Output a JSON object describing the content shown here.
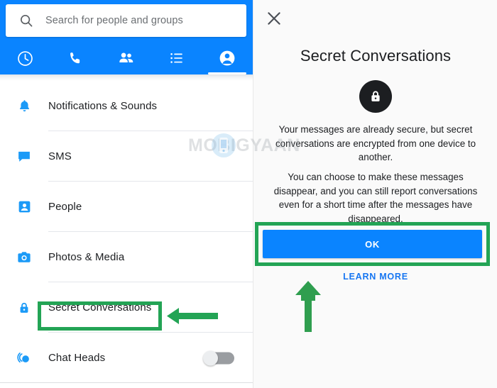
{
  "left_panel": {
    "search": {
      "placeholder": "Search for people and groups",
      "icon": "search-icon"
    },
    "tabs": [
      {
        "name": "recent",
        "icon": "clock-icon",
        "active": false
      },
      {
        "name": "calls",
        "icon": "phone-icon",
        "active": false
      },
      {
        "name": "people",
        "icon": "people-icon",
        "active": false
      },
      {
        "name": "groups",
        "icon": "list-icon",
        "active": false
      },
      {
        "name": "profile",
        "icon": "profile-icon",
        "active": true
      }
    ],
    "settings_items": [
      {
        "label": "Notifications & Sounds",
        "icon": "bell-icon",
        "toggle": null
      },
      {
        "label": "SMS",
        "icon": "message-bubble-icon",
        "toggle": null
      },
      {
        "label": "People",
        "icon": "contact-card-icon",
        "toggle": null
      },
      {
        "label": "Photos & Media",
        "icon": "camera-icon",
        "toggle": null
      },
      {
        "label": "Secret Conversations",
        "icon": "lock-icon",
        "toggle": null
      },
      {
        "label": "Chat Heads",
        "icon": "chat-heads-icon",
        "toggle": "off"
      }
    ]
  },
  "right_panel": {
    "close_label": "×",
    "title": "Secret Conversations",
    "badge_icon": "lock-icon",
    "paragraph_1": "Your messages are already secure, but secret conversations are encrypted from one device to another.",
    "paragraph_2": "You can choose to make these messages disappear, and you can still report conversations even for a short time after the messages have disappeared.",
    "ok_label": "OK",
    "learn_more_label": "LEARN MORE"
  },
  "annotations": {
    "highlight_color": "#23a455",
    "secret_conversations_box": "green-highlight-box",
    "ok_button_box": "green-highlight-box",
    "arrow_left": "green-left-arrow",
    "arrow_up": "green-up-arrow"
  },
  "watermark": {
    "text": "MOBIGYAAN"
  },
  "colors": {
    "brand_blue": "#0a84ff",
    "link_blue": "#1877f2",
    "highlight_green": "#23a455",
    "badge_dark": "#1c1e21",
    "panel_bg": "#fafafa"
  }
}
